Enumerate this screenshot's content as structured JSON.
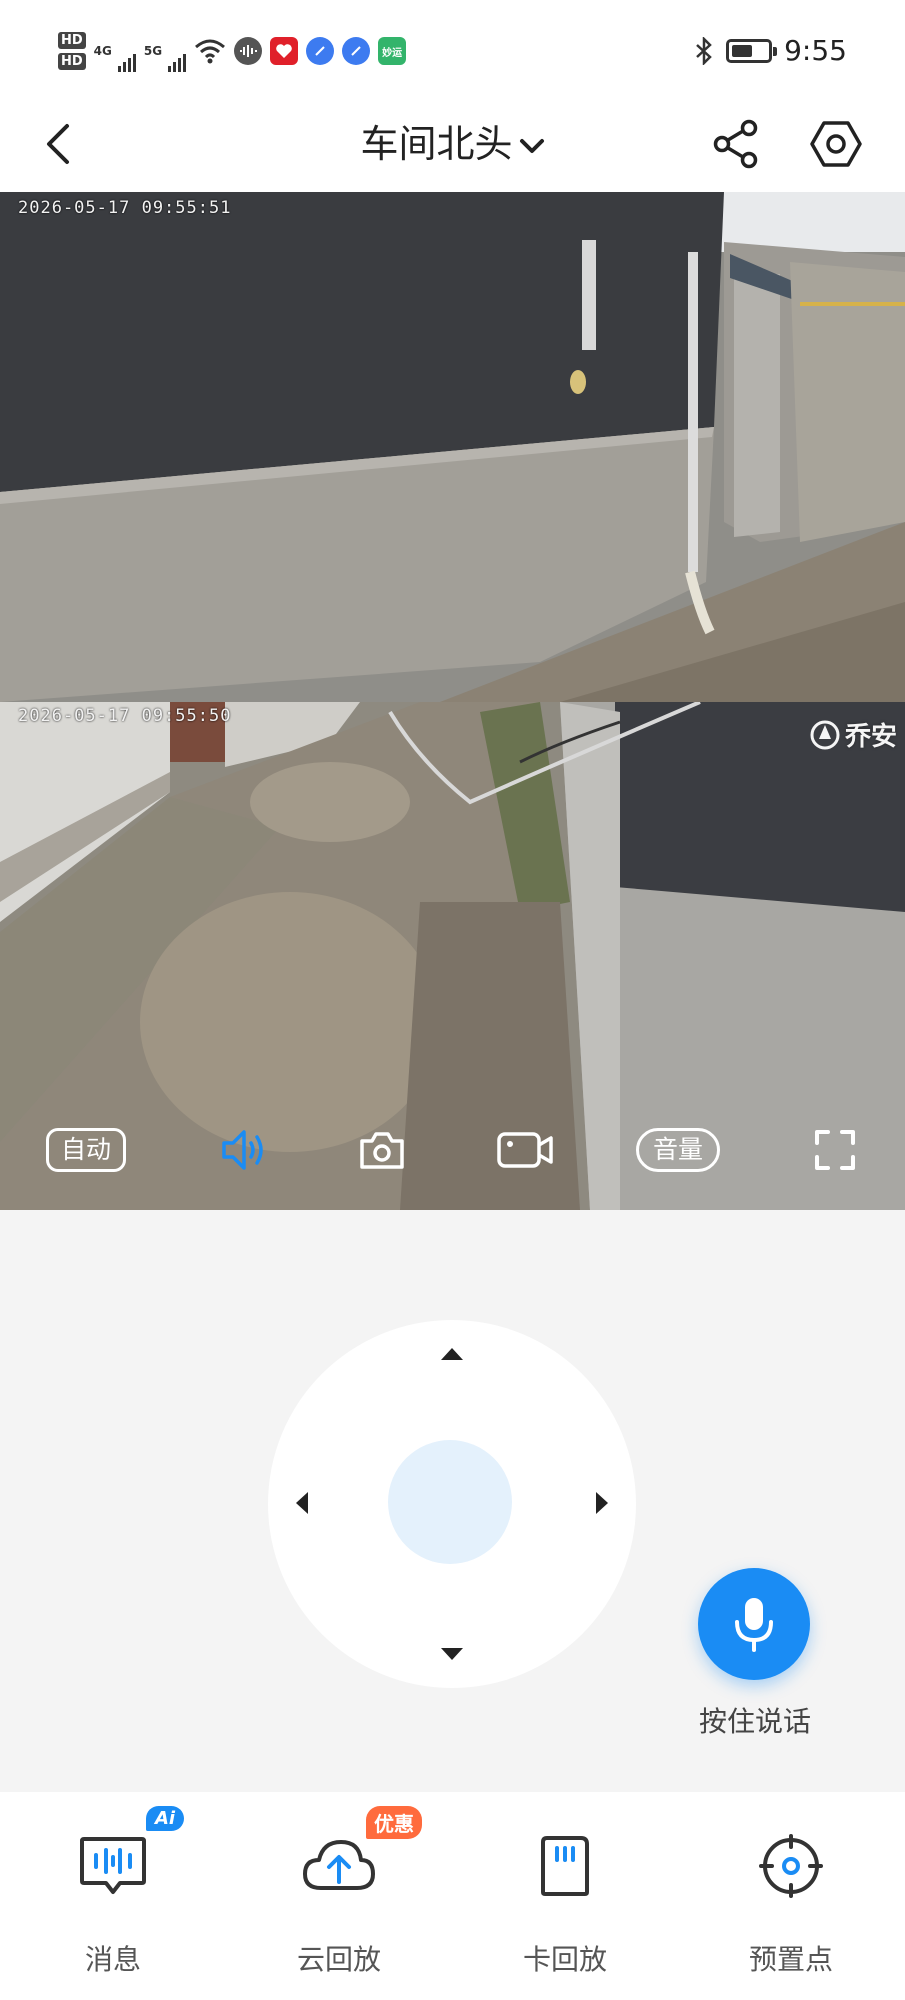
{
  "status_bar": {
    "hd1": "HD",
    "hd2": "HD",
    "net1": "4G",
    "net2": "5G",
    "app_badge_label": "妙运",
    "time": "9:55"
  },
  "header": {
    "title": "车间北头"
  },
  "feeds": [
    {
      "timestamp": "2026-05-17 09:55:51"
    },
    {
      "timestamp": "2026-05-17 09:55:50",
      "watermark": "乔安"
    }
  ],
  "controls": {
    "auto_label": "自动",
    "volume_label": "音量"
  },
  "talk": {
    "label": "按住说话"
  },
  "tabs": [
    {
      "label": "消息",
      "badge": "Ai"
    },
    {
      "label": "云回放",
      "badge": "优惠"
    },
    {
      "label": "卡回放"
    },
    {
      "label": "预置点"
    }
  ],
  "colors": {
    "accent": "#1a8cf4",
    "promo": "#ff6b3d",
    "joystick_center": "#e4f1fc"
  }
}
